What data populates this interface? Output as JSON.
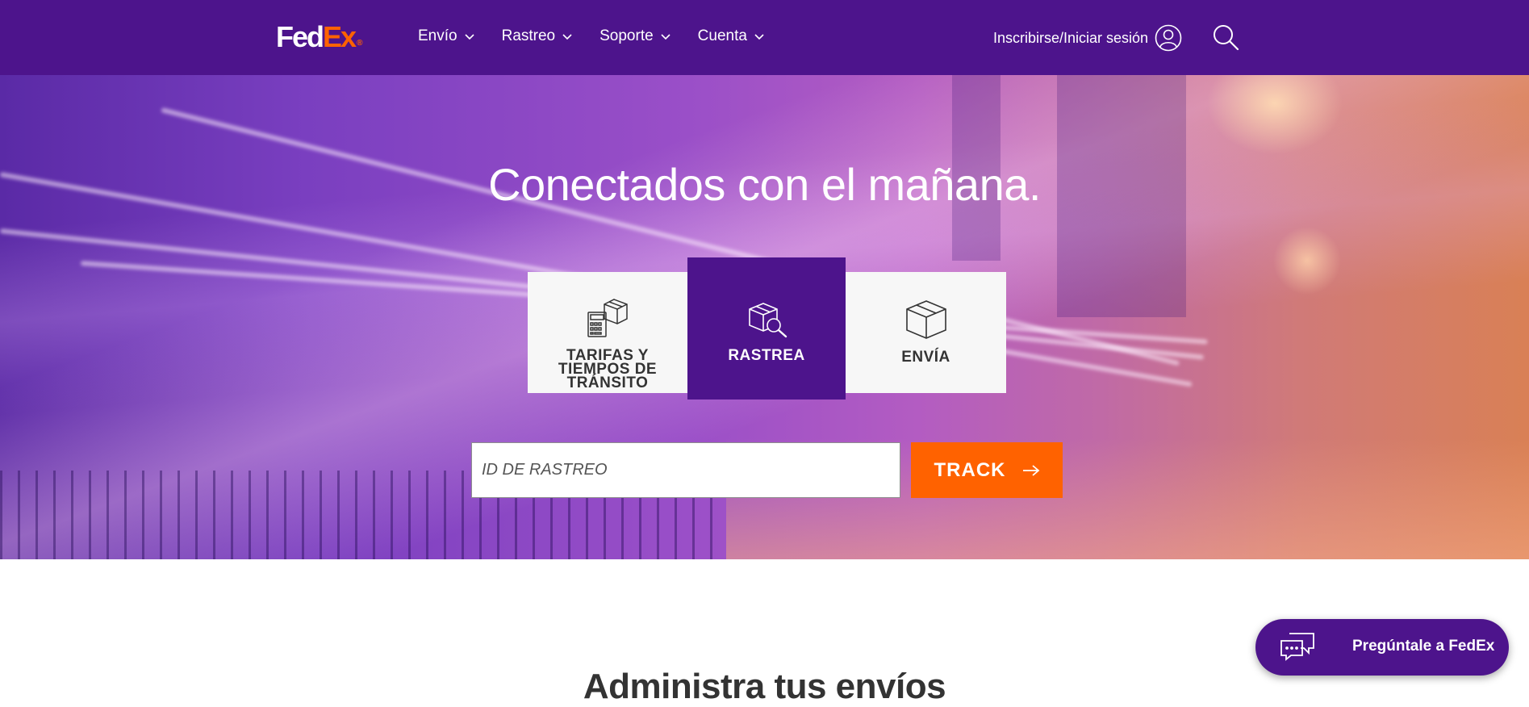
{
  "header": {
    "logo": {
      "fed": "Fed",
      "ex": "Ex",
      "dot": "®"
    },
    "nav": [
      {
        "label": "Envío"
      },
      {
        "label": "Rastreo"
      },
      {
        "label": "Soporte"
      },
      {
        "label": "Cuenta"
      }
    ],
    "signin_label": "Inscribirse/Iniciar sesión",
    "colors": {
      "brand_purple": "#4d148c",
      "brand_orange": "#ff6200"
    }
  },
  "hero": {
    "headline": "Conectados con el mañana.",
    "tabs": [
      {
        "label": "TARIFAS Y TIEMPOS DE TRÁNSITO",
        "icon": "calculator-box-icon",
        "active": false
      },
      {
        "label": "RASTREA",
        "icon": "box-search-icon",
        "active": true
      },
      {
        "label": "ENVÍA",
        "icon": "box-icon",
        "active": false
      }
    ],
    "track_input": {
      "placeholder": "ID DE RASTREO",
      "value": ""
    },
    "track_button_label": "TRACK"
  },
  "main": {
    "section_title": "Administra tus envíos"
  },
  "chat": {
    "label": "Pregúntale a FedEx",
    "icon": "chat-bubbles-icon"
  }
}
